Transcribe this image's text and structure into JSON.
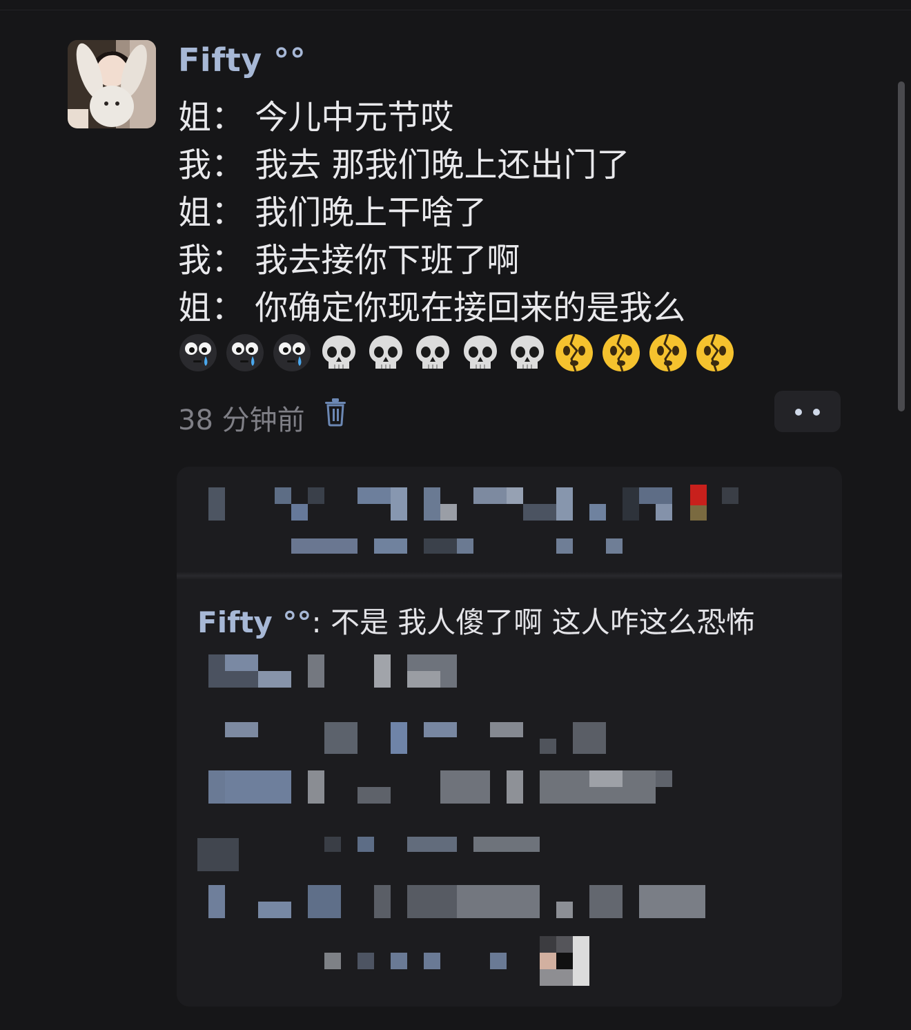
{
  "post": {
    "username": "Fifty °°",
    "lines": [
      "姐：  今儿中元节哎",
      "我：  我去 那我们晚上还出门了",
      "姐：  我们晚上干啥了",
      "我：  我去接你下班了啊",
      "姐：  你确定你现在接回来的是我么"
    ],
    "emojis": [
      "crying-face",
      "crying-face",
      "crying-face",
      "skull",
      "skull",
      "skull",
      "skull",
      "skull",
      "broken-face",
      "broken-face",
      "broken-face",
      "broken-face"
    ],
    "timestamp": "38 分钟前"
  },
  "reply": {
    "name": "Fifty °°",
    "separator": ": ",
    "text": "不是 我人傻了啊 这人咋这么恐怖"
  },
  "colors": {
    "background": "#161618",
    "username": "#a7b8d6",
    "text": "#e9e9ec",
    "muted": "#7f7f86",
    "panel": "#1c1c1f"
  }
}
